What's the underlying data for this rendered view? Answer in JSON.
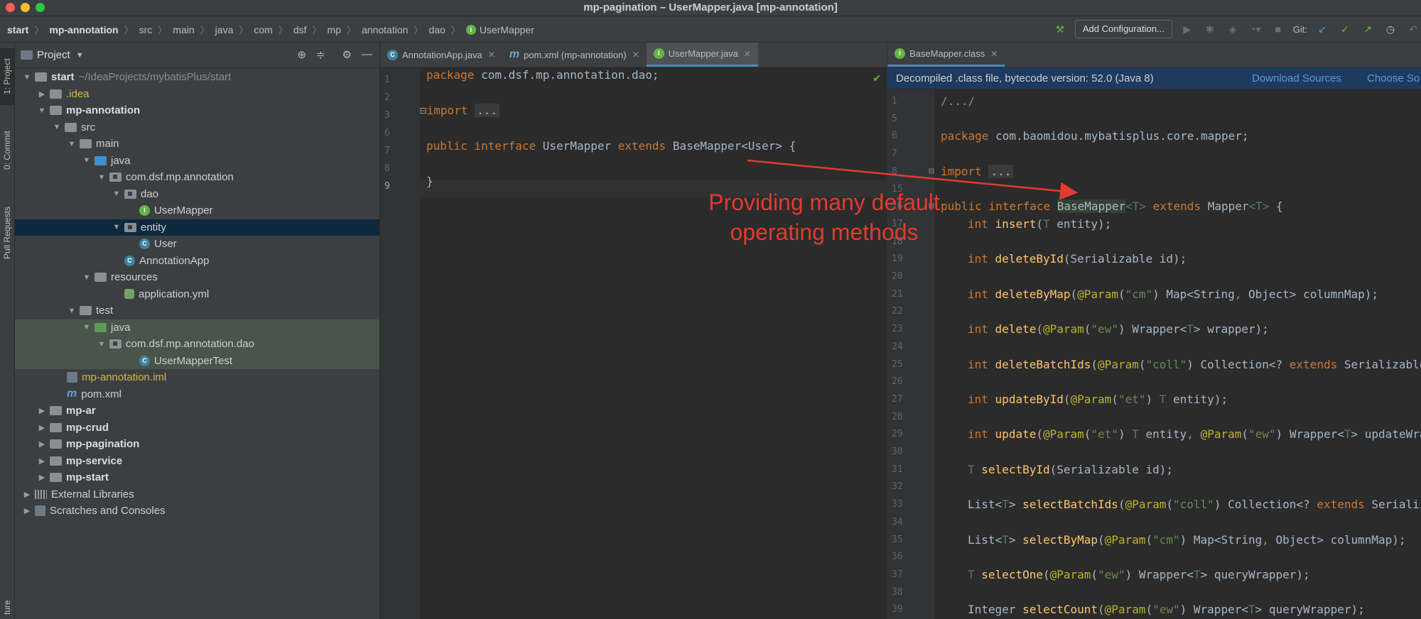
{
  "window": {
    "title": "mp-pagination – UserMapper.java [mp-annotation]",
    "traffic_colors": [
      "#ff5f57",
      "#febc2e",
      "#28c840"
    ]
  },
  "breadcrumb": [
    "start",
    "mp-annotation",
    "src",
    "main",
    "java",
    "com",
    "dsf",
    "mp",
    "annotation",
    "dao",
    "UserMapper"
  ],
  "toolbar": {
    "add_configuration": "Add Configuration...",
    "git_label": "Git:"
  },
  "left_stripe": {
    "project_tab": "1: Project",
    "commit_tab": "0: Commit",
    "pull_requests_tab": "Pull Requests",
    "structure_tab": "ture"
  },
  "project_panel": {
    "title": "Project",
    "tree": [
      {
        "label": "start",
        "suffix": "~/IdeaProjects/mybatisPlus/start"
      },
      {
        "label": ".idea"
      },
      {
        "label": "mp-annotation"
      },
      {
        "label": "src"
      },
      {
        "label": "main"
      },
      {
        "label": "java"
      },
      {
        "label": "com.dsf.mp.annotation"
      },
      {
        "label": "dao"
      },
      {
        "label": "UserMapper"
      },
      {
        "label": "entity"
      },
      {
        "label": "User"
      },
      {
        "label": "AnnotationApp"
      },
      {
        "label": "resources"
      },
      {
        "label": "application.yml"
      },
      {
        "label": "test"
      },
      {
        "label": "java"
      },
      {
        "label": "com.dsf.mp.annotation.dao"
      },
      {
        "label": "UserMapperTest"
      },
      {
        "label": "mp-annotation.iml"
      },
      {
        "label": "pom.xml"
      },
      {
        "label": "mp-ar"
      },
      {
        "label": "mp-crud"
      },
      {
        "label": "mp-pagination"
      },
      {
        "label": "mp-service"
      },
      {
        "label": "mp-start"
      },
      {
        "label": "External Libraries"
      },
      {
        "label": "Scratches and Consoles"
      }
    ]
  },
  "editor_left": {
    "tabs": [
      "AnnotationApp.java",
      "pom.xml (mp-annotation)",
      "UserMapper.java"
    ],
    "line_numbers": [
      "1",
      "2",
      "3",
      "6",
      "7",
      "8",
      "9"
    ],
    "code": {
      "l1_kw": "package",
      "l1_rest": " com.dsf.mp.annotation.dao;",
      "l3_kw": "import",
      "l3_fold": "...",
      "l6_kw1": "public",
      "l6_kw2": "interface",
      "l6_name": "UserMapper",
      "l6_kw3": "extends",
      "l6_rest": "BaseMapper<User> {",
      "l8": "}"
    }
  },
  "editor_right": {
    "tab": "BaseMapper.class",
    "banner": "Decompiled .class file, bytecode version: 52.0 (Java 8)",
    "download_sources": "Download Sources",
    "choose_sources": "Choose So",
    "line_numbers": [
      "1",
      "5",
      "6",
      "7",
      "8",
      "15",
      "16",
      "17",
      "18",
      "19",
      "20",
      "21",
      "22",
      "23",
      "24",
      "25",
      "26",
      "27",
      "28",
      "29",
      "30",
      "31",
      "32",
      "33",
      "34",
      "35",
      "36",
      "37",
      "38",
      "39"
    ],
    "code": {
      "l1": "/.../",
      "l6_kw": "package",
      "l6_rest": " com.baomidou.mybatisplus.core.mapper;",
      "l8_kw": "import",
      "l8_fold": "...",
      "l16_kw": "public interface",
      "l16_name": "BaseMapper",
      "l16_t1": "<T>",
      "l16_ext": "extends",
      "l16_m": "Mapper",
      "l16_t2": "<T>",
      "l16_end": " {",
      "m17": [
        "int",
        "insert",
        "(",
        "",
        "",
        "T",
        " entity);"
      ],
      "m19": [
        "int",
        "deleteById",
        "(Serializable id);"
      ],
      "m21": [
        "int",
        "deleteByMap",
        "(",
        "@Param",
        "(",
        "\"cm\"",
        ") Map<String",
        ",",
        " Object> columnMap);"
      ],
      "m23": [
        "int",
        "delete",
        "(",
        "@Param",
        "(",
        "\"ew\"",
        ") Wrapper<",
        "T",
        "> wrapper);"
      ],
      "m25": [
        "int",
        "deleteBatchIds",
        "(",
        "@Param",
        "(",
        "\"coll\"",
        ") Collection<? ",
        "extends",
        " Serializable>"
      ],
      "m27": [
        "int",
        "updateById",
        "(",
        "@Param",
        "(",
        "\"et\"",
        ") ",
        "T",
        " entity);"
      ],
      "m29": [
        "int",
        "update",
        "(",
        "@Param",
        "(",
        "\"et\"",
        ") ",
        "T",
        " entity",
        ",",
        " ",
        "@Param",
        "(",
        "\"ew\"",
        ") Wrapper<",
        "T",
        "> updateWrap"
      ],
      "m31": [
        "T",
        "selectById",
        "(Serializable id);"
      ],
      "m33": [
        "List<",
        "T",
        "> ",
        "selectBatchIds",
        "(",
        "@Param",
        "(",
        "\"coll\"",
        ") Collection<? ",
        "extends",
        " Serializa"
      ],
      "m35": [
        "List<",
        "T",
        "> ",
        "selectByMap",
        "(",
        "@Param",
        "(",
        "\"cm\"",
        ") Map<String",
        ",",
        " Object> columnMap);"
      ],
      "m37": [
        "T",
        "selectOne",
        "(",
        "@Param",
        "(",
        "\"ew\"",
        ") Wrapper<",
        "T",
        "> queryWrapper);"
      ],
      "m39": [
        "Integer ",
        "selectCount",
        "(",
        "@Param",
        "(",
        "\"ew\"",
        ") Wrapper<",
        "T",
        "> queryWrapper);"
      ]
    }
  },
  "annotation": {
    "text_line1": "Providing many default",
    "text_line2": "operating methods",
    "color": "#e23b30"
  }
}
